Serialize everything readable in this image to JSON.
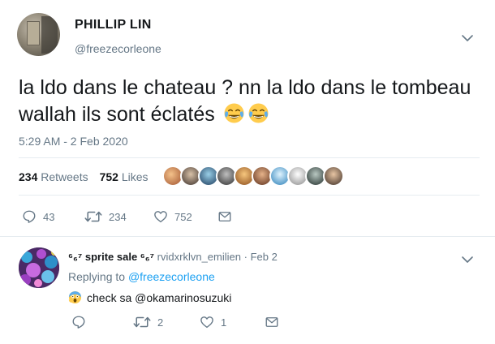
{
  "tweet": {
    "display_name": "PHILLIP LIN",
    "handle": "@freezecorleone",
    "text": "la ldo dans le chateau ? nn la ldo dans le tombeau wallah ils sont éclatés",
    "emoji": [
      "face-with-tears-of-joy",
      "face-with-tears-of-joy"
    ],
    "timestamp": "5:29 AM - 2 Feb 2020",
    "retweets_count": "234",
    "retweets_label": "Retweets",
    "likes_count": "752",
    "likes_label": "Likes",
    "actions": {
      "reply_count": "43",
      "retweet_count": "234",
      "like_count": "752"
    }
  },
  "reply": {
    "display_name": "⁶₆⁷ sprite sale ⁶₆⁷",
    "handle": "rvidxrklvn_emilien",
    "separator": "·",
    "date": "Feb 2",
    "replying_label": "Replying to",
    "replying_to": "@freezecorleone",
    "text": "check sa @okamarinosuzuki",
    "emoji": "face-screaming-in-fear",
    "actions": {
      "reply_count": "",
      "retweet_count": "2",
      "like_count": "1"
    }
  },
  "colors": {
    "text": "#14171a",
    "secondary": "#657786",
    "link": "#1da1f2",
    "divider": "#e6ecf0"
  }
}
